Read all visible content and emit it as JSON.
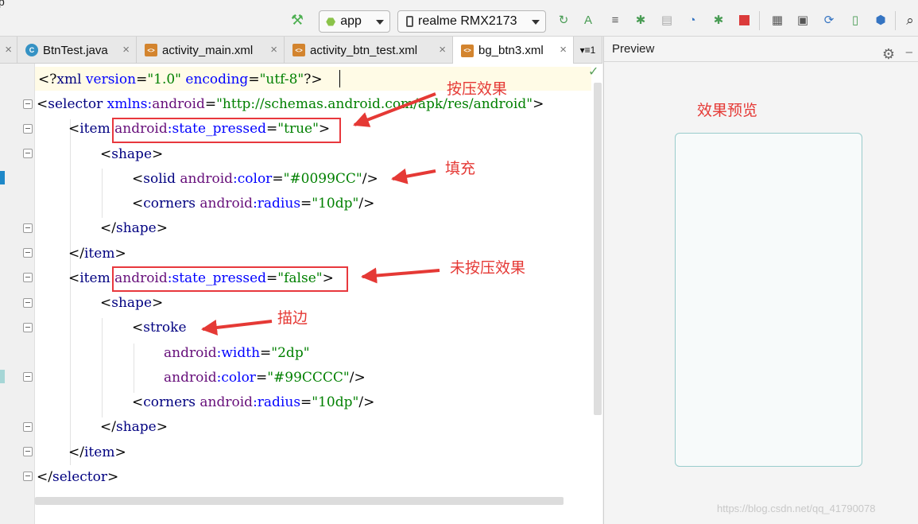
{
  "toolbar": {
    "cut_text": "p",
    "run_config": "app",
    "device": "realme RMX2173",
    "colors": {
      "build": "#4caf50",
      "run": "#499c54",
      "stop": "#db3b3b"
    }
  },
  "tabs": [
    {
      "label": "BtnTest.java",
      "icon": "java-class-icon"
    },
    {
      "label": "activity_main.xml",
      "icon": "xml-file-icon"
    },
    {
      "label": "activity_btn_test.xml",
      "icon": "xml-file-icon"
    },
    {
      "label": "bg_btn3.xml",
      "icon": "xml-file-icon",
      "active": true
    }
  ],
  "tab_overflow": "▾≡1",
  "preview": {
    "title": "Preview",
    "stroke_color": "#99CCCC"
  },
  "code": {
    "l1": {
      "a": "<?",
      "b": "xml ",
      "c": "version",
      "d": "=",
      "e": "\"1.0\"",
      "f": " encoding",
      "g": "=",
      "h": "\"utf-8\"",
      "i": "?>"
    },
    "l2": {
      "a": "<",
      "b": "selector ",
      "c": "xmlns:",
      "d": "android",
      "e": "=",
      "f": "\"http://schemas.android.com/apk/res/android\"",
      "g": ">"
    },
    "l3": {
      "a": "<",
      "b": "item ",
      "c": "android",
      "d": ":state_pressed",
      "e": "=",
      "f": "\"true\"",
      "g": ">"
    },
    "l4": {
      "a": "<",
      "b": "shape",
      "c": ">"
    },
    "l5": {
      "a": "<",
      "b": "solid ",
      "c": "android",
      "d": ":color",
      "e": "=",
      "f": "\"#0099CC\"",
      "g": "/>"
    },
    "l6": {
      "a": "<",
      "b": "corners ",
      "c": "android",
      "d": ":radius",
      "e": "=",
      "f": "\"10dp\"",
      "g": "/>"
    },
    "l7": {
      "a": "</",
      "b": "shape",
      "c": ">"
    },
    "l8": {
      "a": "</",
      "b": "item",
      "c": ">"
    },
    "l9": {
      "a": "<",
      "b": "item ",
      "c": "android",
      "d": ":state_pressed",
      "e": "=",
      "f": "\"false\"",
      "g": ">"
    },
    "l10": {
      "a": "<",
      "b": "shape",
      "c": ">"
    },
    "l11": {
      "a": "<",
      "b": "stroke"
    },
    "l12": {
      "c": "android",
      "d": ":width",
      "e": "=",
      "f": "\"2dp\""
    },
    "l13": {
      "c": "android",
      "d": ":color",
      "e": "=",
      "f": "\"#99CCCC\"",
      "g": "/>"
    },
    "l14": {
      "a": "<",
      "b": "corners ",
      "c": "android",
      "d": ":radius",
      "e": "=",
      "f": "\"10dp\"",
      "g": "/>"
    },
    "l15": {
      "a": "</",
      "b": "shape",
      "c": ">"
    },
    "l16": {
      "a": "</",
      "b": "item",
      "c": ">"
    },
    "l17": {
      "a": "</",
      "b": "selector",
      "c": ">"
    }
  },
  "annotations": {
    "pressed": "按压效果",
    "fill": "填充",
    "unpressed": "未按压效果",
    "stroke": "描边",
    "preview": "效果预览",
    "color": "#e53935"
  },
  "watermark": "https://blog.csdn.net/qq_41790078"
}
